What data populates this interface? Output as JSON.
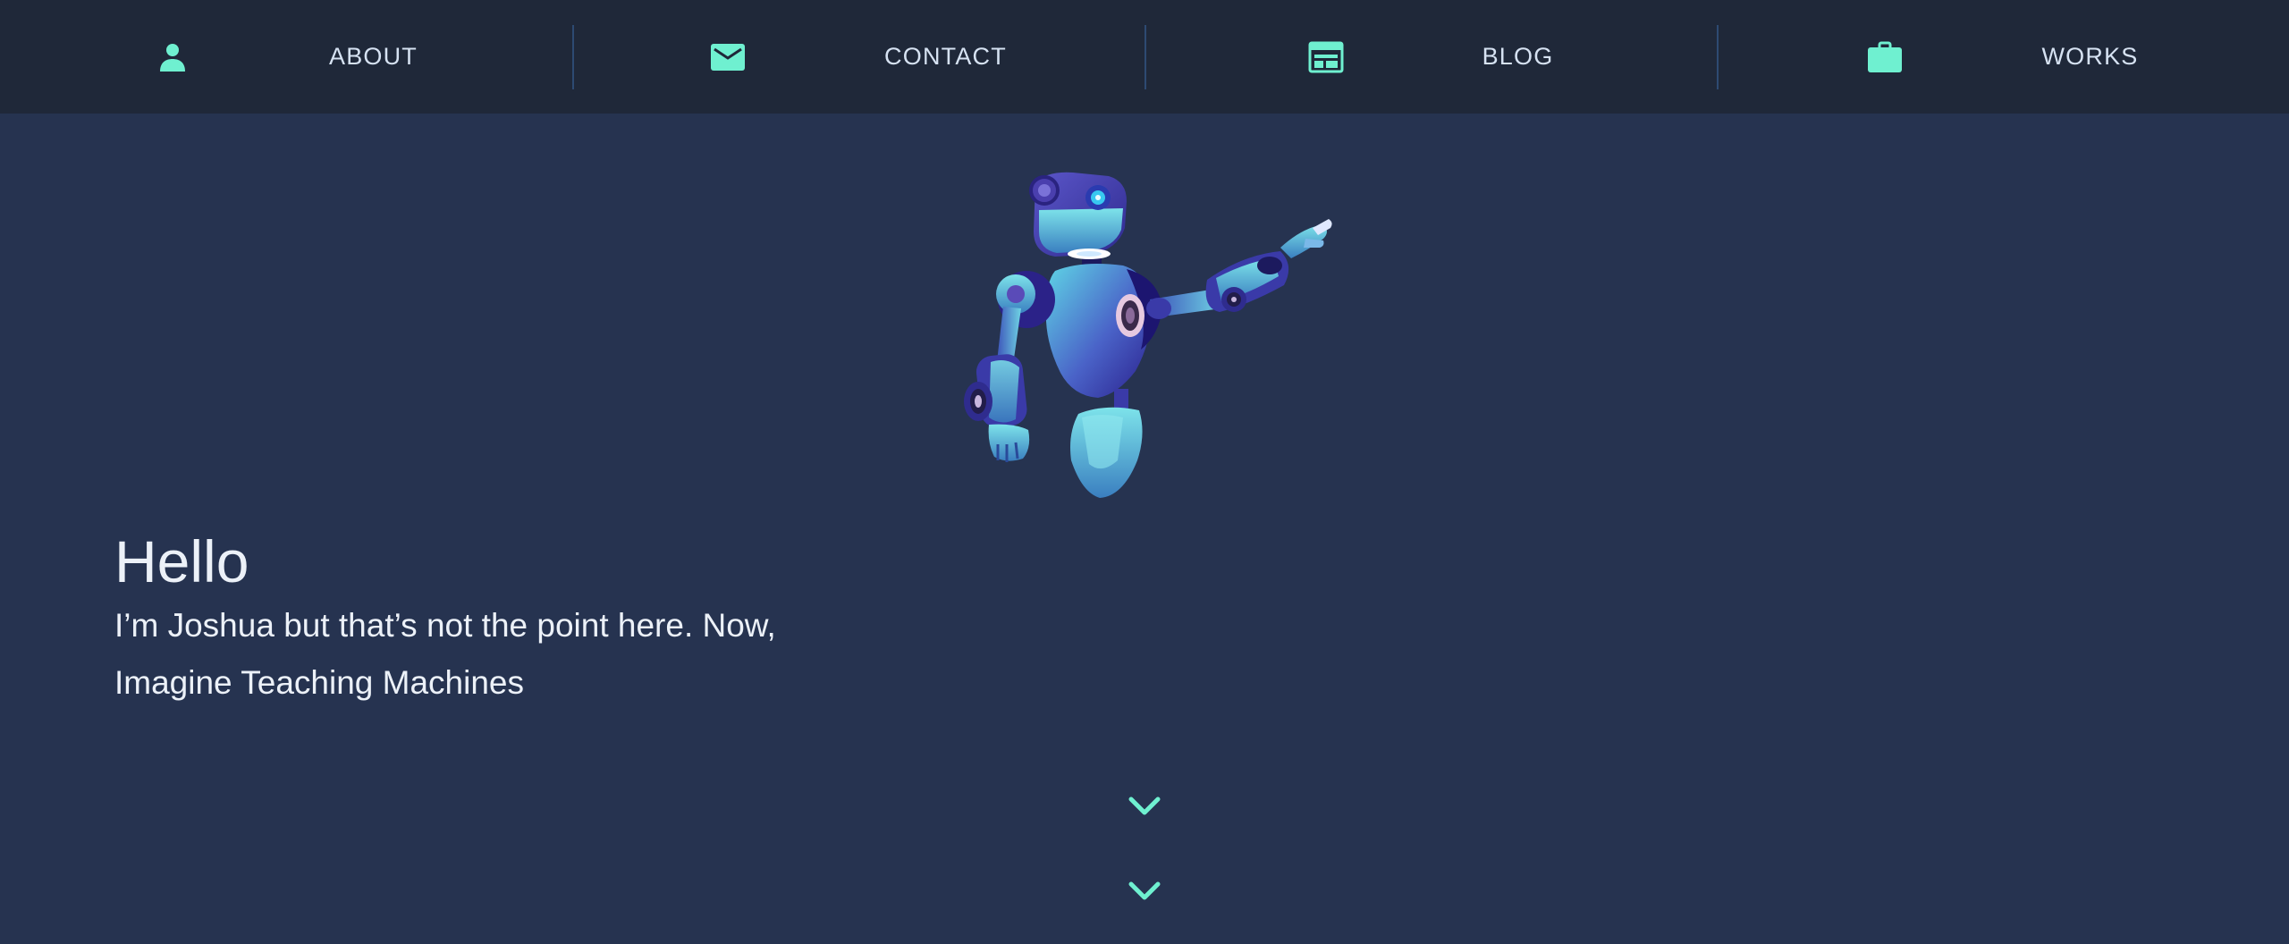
{
  "nav": {
    "items": [
      {
        "label": "ABOUT",
        "icon": "person-icon"
      },
      {
        "label": "CONTACT",
        "icon": "mail-icon"
      },
      {
        "label": "BLOG",
        "icon": "newspaper-icon"
      },
      {
        "label": "WORKS",
        "icon": "briefcase-icon"
      }
    ]
  },
  "hero": {
    "title": "Hello",
    "line1": "I’m Joshua but that’s not the point here. Now,",
    "line2": "Imagine Teaching Machines",
    "illustration": "robot-illustration"
  },
  "scroll": {
    "icon": "chevron-down-icon"
  },
  "colors": {
    "background": "#263350",
    "navbar": "#1f2839",
    "accent": "#6ff0d0",
    "text": "#ecf1f8"
  }
}
